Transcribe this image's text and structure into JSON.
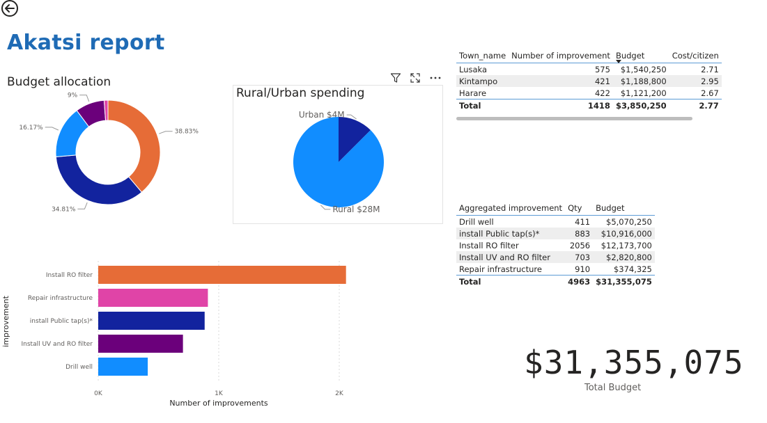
{
  "page_title": "Akatsi report",
  "toolbar": {
    "icons": [
      "filter-icon",
      "focus-mode-icon",
      "more-options-icon"
    ]
  },
  "budget_allocation": {
    "title": "Budget allocation",
    "labels": [
      "38.83%",
      "34.81%",
      "16.17%",
      "9%"
    ],
    "colors": [
      "#e66c37",
      "#12239e",
      "#118dff",
      "#6b007b",
      "#e044a7"
    ]
  },
  "rural_urban": {
    "title": "Rural/Urban spending",
    "urban_label": "Urban $4M",
    "rural_label": "Rural $28M",
    "colors": {
      "rural": "#118dff",
      "urban": "#12239e"
    }
  },
  "town_table": {
    "headers": [
      "Town_name",
      "Number of improvement",
      "Budget",
      "Cost/citizen"
    ],
    "rows": [
      [
        "Lusaka",
        "575",
        "$1,540,250",
        "2.71"
      ],
      [
        "Kintampo",
        "421",
        "$1,188,800",
        "2.95"
      ],
      [
        "Harare",
        "422",
        "$1,121,200",
        "2.67"
      ]
    ],
    "total": [
      "Total",
      "1418",
      "$3,850,250",
      "2.77"
    ]
  },
  "agg_table": {
    "headers": [
      "Aggregated improvement",
      "Qty",
      "Budget"
    ],
    "rows": [
      [
        "Drill well",
        "411",
        "$5,070,250"
      ],
      [
        "install Public tap(s)*",
        "883",
        "$10,916,000"
      ],
      [
        "Install RO filter",
        "2056",
        "$12,173,700"
      ],
      [
        "Install UV and RO filter",
        "703",
        "$2,820,800"
      ],
      [
        "Repair infrastructure",
        "910",
        "$374,325"
      ]
    ],
    "total": [
      "Total",
      "4963",
      "$31,355,075"
    ]
  },
  "kpi": {
    "value": "$31,355,075",
    "label": "Total Budget"
  },
  "chart_data": [
    {
      "type": "pie",
      "variant": "donut",
      "title": "Budget allocation",
      "categories": [
        "",
        "",
        "",
        "",
        ""
      ],
      "values": [
        38.83,
        34.81,
        16.17,
        9.0,
        1.19
      ],
      "labels": [
        "38.83%",
        "34.81%",
        "16.17%",
        "9%",
        ""
      ],
      "colors": [
        "#e66c37",
        "#12239e",
        "#118dff",
        "#6b007b",
        "#e044a7"
      ]
    },
    {
      "type": "pie",
      "title": "Rural/Urban spending",
      "categories": [
        "Rural",
        "Urban"
      ],
      "values": [
        28,
        4
      ],
      "labels": [
        "Rural $28M",
        "Urban $4M"
      ],
      "unit": "$M",
      "colors": [
        "#118dff",
        "#12239e"
      ]
    },
    {
      "type": "bar",
      "orientation": "horizontal",
      "title": "",
      "categories": [
        "Install RO filter",
        "Repair infrastructure",
        "install Public tap(s)*",
        "Install UV and RO filter",
        "Drill well"
      ],
      "values": [
        2056,
        910,
        883,
        703,
        411
      ],
      "colors": [
        "#e66c37",
        "#e044a7",
        "#12239e",
        "#6b007b",
        "#118dff"
      ],
      "xlabel": "Number of improvements",
      "ylabel": "improvement",
      "xlim": [
        0,
        2000
      ],
      "xticks": [
        "0K",
        "1K",
        "2K"
      ],
      "grid": true
    }
  ]
}
